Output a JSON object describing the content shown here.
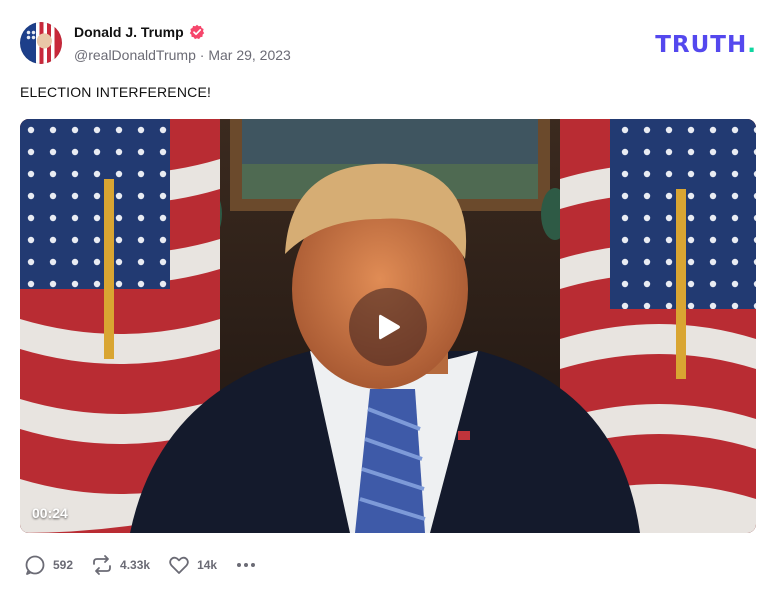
{
  "post": {
    "author": {
      "display_name": "Donald J. Trump",
      "verified": true,
      "verified_color": "#f6466b",
      "handle": "@realDonaldTrump",
      "date": "Mar 29, 2023"
    },
    "separator": "·",
    "brand": {
      "text": "TRUTH",
      "dot": ".",
      "color": "#5448ee",
      "dot_color": "#0fd6a0"
    },
    "text": "ELECTION INTERFERENCE!",
    "video": {
      "duration": "00:24"
    },
    "actions": {
      "replies": "592",
      "retruths": "4.33k",
      "likes": "14k"
    }
  },
  "icons": [
    "verified-badge-icon",
    "play-icon",
    "reply-icon",
    "retruth-icon",
    "heart-icon",
    "more-icon"
  ]
}
